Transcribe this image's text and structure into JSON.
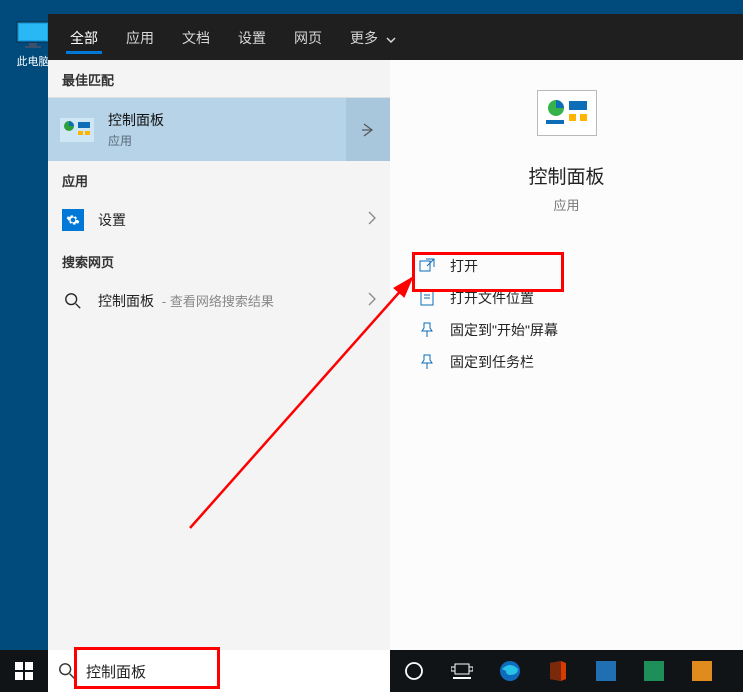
{
  "desktop": {
    "this_pc_label": "此电脑"
  },
  "tabs": {
    "all": "全部",
    "apps": "应用",
    "docs": "文档",
    "settings": "设置",
    "web": "网页",
    "more": "更多"
  },
  "left": {
    "section_best": "最佳匹配",
    "best_item": {
      "title": "控制面板",
      "sub": "应用"
    },
    "section_apps": "应用",
    "settings_item": "设置",
    "section_web": "搜索网页",
    "web_item_label": "控制面板",
    "web_item_sub": "- 查看网络搜索结果"
  },
  "preview": {
    "title": "控制面板",
    "sub": "应用",
    "actions": {
      "open": "打开",
      "open_loc": "打开文件位置",
      "pin_start": "固定到\"开始\"屏幕",
      "pin_taskbar": "固定到任务栏"
    }
  },
  "search": {
    "value": "控制面板"
  }
}
